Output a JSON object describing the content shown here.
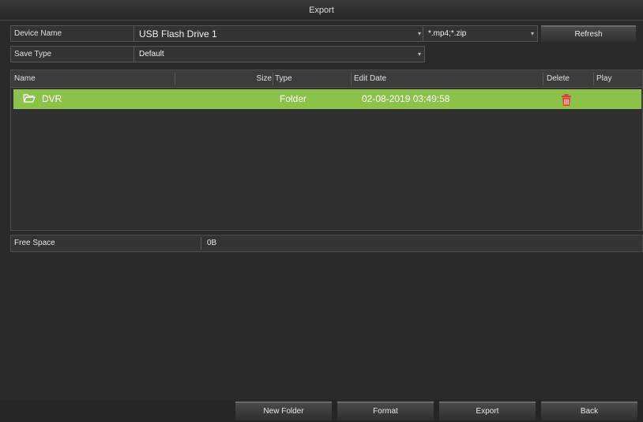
{
  "window": {
    "title": "Export"
  },
  "device": {
    "label": "Device Name",
    "value": "USB Flash Drive 1",
    "filter_value": "*.mp4;*.zip",
    "refresh_label": "Refresh"
  },
  "save_type": {
    "label": "Save Type",
    "value": "Default"
  },
  "table": {
    "columns": {
      "name": "Name",
      "size": "Size",
      "type": "Type",
      "edit_date": "Edit Date",
      "delete": "Delete",
      "play": "Play"
    },
    "rows": [
      {
        "name": "DVR",
        "size": "",
        "type": "Folder",
        "edit_date": "02-08-2019 03:49:58",
        "selected": true
      }
    ]
  },
  "free_space": {
    "label": "Free Space",
    "value": "0B"
  },
  "buttons": {
    "new_folder": "New Folder",
    "format": "Format",
    "export": "Export",
    "back": "Back"
  },
  "colors": {
    "selected_row": "#8bc34a",
    "delete_icon": "#e53935"
  },
  "icons": {
    "folder": "folder-open-icon",
    "delete": "trash-icon"
  }
}
